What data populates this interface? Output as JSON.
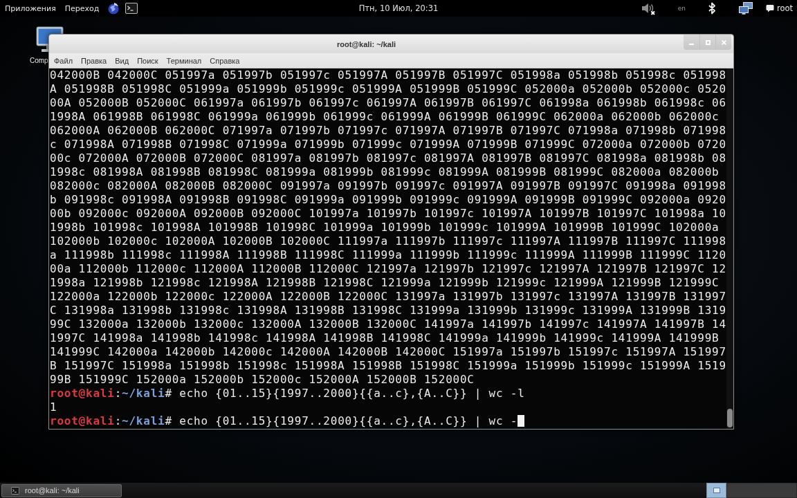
{
  "top_panel": {
    "menus": [
      {
        "label": "Приложения"
      },
      {
        "label": "Переход"
      }
    ],
    "launchers": [
      {
        "kind": "browser"
      },
      {
        "kind": "terminal"
      }
    ],
    "clock": "Птн, 10 Июл, 20:31",
    "tray": [
      {
        "kind": "volume",
        "muted": true
      },
      {
        "kind": "keyboard",
        "label": "en"
      },
      {
        "kind": "bluetooth"
      },
      {
        "kind": "network"
      },
      {
        "kind": "user",
        "label": "root"
      }
    ]
  },
  "desktop_icons": [
    {
      "label": "Comp"
    }
  ],
  "window": {
    "title": "root@kali: ~/kali",
    "menu": [
      "Файл",
      "Правка",
      "Вид",
      "Поиск",
      "Терминал",
      "Справка"
    ],
    "lines": [
      {
        "kind": "output",
        "text": "042000B 042000C 051997a 051997b 051997c 051997A 051997B 051997C 051998a 051998b 051998c 051998"
      },
      {
        "kind": "output",
        "text": "A 051998B 051998C 051999a 051999b 051999c 051999A 051999B 051999C 052000a 052000b 052000c 0520"
      },
      {
        "kind": "output",
        "text": "00A 052000B 052000C 061997a 061997b 061997c 061997A 061997B 061997C 061998a 061998b 061998c 06"
      },
      {
        "kind": "output",
        "text": "1998A 061998B 061998C 061999a 061999b 061999c 061999A 061999B 061999C 062000a 062000b 062000c"
      },
      {
        "kind": "output",
        "text": "062000A 062000B 062000C 071997a 071997b 071997c 071997A 071997B 071997C 071998a 071998b 071998"
      },
      {
        "kind": "output",
        "text": "c 071998A 071998B 071998C 071999a 071999b 071999c 071999A 071999B 071999C 072000a 072000b 0720"
      },
      {
        "kind": "output",
        "text": "00c 072000A 072000B 072000C 081997a 081997b 081997c 081997A 081997B 081997C 081998a 081998b 08"
      },
      {
        "kind": "output",
        "text": "1998c 081998A 081998B 081998C 081999a 081999b 081999c 081999A 081999B 081999C 082000a 082000b"
      },
      {
        "kind": "output",
        "text": "082000c 082000A 082000B 082000C 091997a 091997b 091997c 091997A 091997B 091997C 091998a 091998"
      },
      {
        "kind": "output",
        "text": "b 091998c 091998A 091998B 091998C 091999a 091999b 091999c 091999A 091999B 091999C 092000a 0920"
      },
      {
        "kind": "output",
        "text": "00b 092000c 092000A 092000B 092000C 101997a 101997b 101997c 101997A 101997B 101997C 101998a 10"
      },
      {
        "kind": "output",
        "text": "1998b 101998c 101998A 101998B 101998C 101999a 101999b 101999c 101999A 101999B 101999C 102000a"
      },
      {
        "kind": "output",
        "text": "102000b 102000c 102000A 102000B 102000C 111997a 111997b 111997c 111997A 111997B 111997C 111998"
      },
      {
        "kind": "output",
        "text": "a 111998b 111998c 111998A 111998B 111998C 111999a 111999b 111999c 111999A 111999B 111999C 1120"
      },
      {
        "kind": "output",
        "text": "00a 112000b 112000c 112000A 112000B 112000C 121997a 121997b 121997c 121997A 121997B 121997C 12"
      },
      {
        "kind": "output",
        "text": "1998a 121998b 121998c 121998A 121998B 121998C 121999a 121999b 121999c 121999A 121999B 121999C"
      },
      {
        "kind": "output",
        "text": "122000a 122000b 122000c 122000A 122000B 122000C 131997a 131997b 131997c 131997A 131997B 131997"
      },
      {
        "kind": "output",
        "text": "C 131998a 131998b 131998c 131998A 131998B 131998C 131999a 131999b 131999c 131999A 131999B 1319"
      },
      {
        "kind": "output",
        "text": "99C 132000a 132000b 132000c 132000A 132000B 132000C 141997a 141997b 141997c 141997A 141997B 14"
      },
      {
        "kind": "output",
        "text": "1997C 141998a 141998b 141998c 141998A 141998B 141998C 141999a 141999b 141999c 141999A 141999B"
      },
      {
        "kind": "output",
        "text": "141999C 142000a 142000b 142000c 142000A 142000B 142000C 151997a 151997b 151997c 151997A 151997"
      },
      {
        "kind": "output",
        "text": "B 151997C 151998a 151998b 151998c 151998A 151998B 151998C 151999a 151999b 151999c 151999A 1519"
      },
      {
        "kind": "output",
        "text": "99B 151999C 152000a 152000b 152000c 152000A 152000B 152000C"
      },
      {
        "kind": "prompt",
        "user": "root@kali",
        "separator": ":",
        "path": "~/kali",
        "symbol": "#",
        "command": "echo {01..15}{1997..2000}{{a..c},{A..C}} | wc -l",
        "cursor": false
      },
      {
        "kind": "output",
        "text": "1"
      },
      {
        "kind": "prompt",
        "user": "root@kali",
        "separator": ":",
        "path": "~/kali",
        "symbol": "#",
        "command": "echo {01..15}{1997..2000}{{a..c},{A..C}} | wc -",
        "cursor": true
      }
    ]
  },
  "taskbar": {
    "tasks": [
      {
        "label": "root@kali: ~/kali",
        "selected": true
      }
    ],
    "workspaces": [
      {
        "selected": true
      },
      {
        "selected": false
      }
    ]
  }
}
